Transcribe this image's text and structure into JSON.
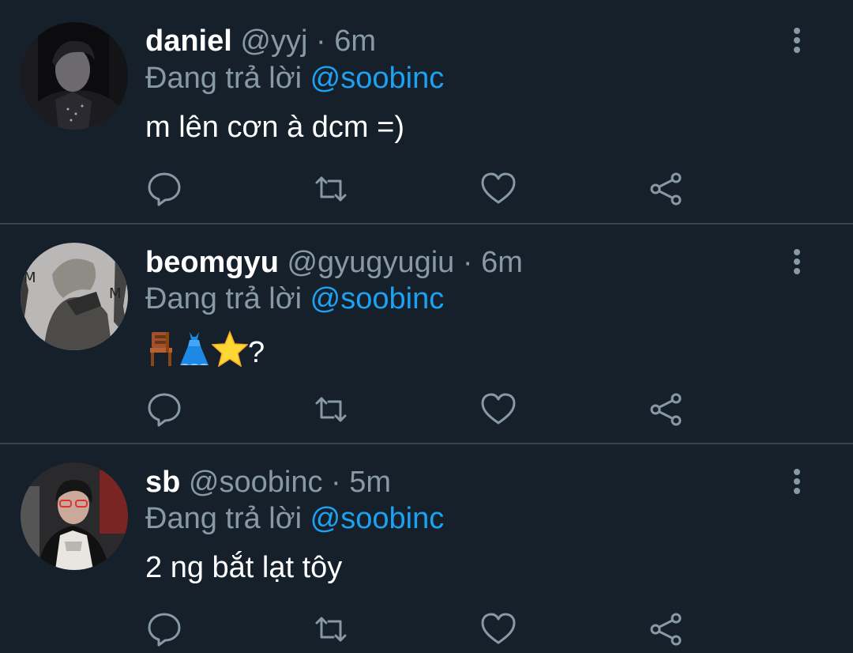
{
  "tweets": [
    {
      "name": "daniel",
      "handle": "@yyj",
      "separator": "·",
      "time": "6m",
      "reply_prefix": "Đang trả lời",
      "reply_to": "@soobinc",
      "text": "m lên cơn à dcm =)"
    },
    {
      "name": "beomgyu",
      "handle": "@gyugyugiu",
      "separator": "·",
      "time": "6m",
      "reply_prefix": "Đang trả lời",
      "reply_to": "@soobinc",
      "emojis": [
        "chair",
        "dress",
        "star"
      ],
      "text": "?"
    },
    {
      "name": "sb",
      "handle": "@soobinc",
      "separator": "·",
      "time": "5m",
      "reply_prefix": "Đang trả lời",
      "reply_to": "@soobinc",
      "text": "2 ng bắt lạt tôy"
    }
  ],
  "icons": {
    "reply": "reply-icon",
    "retweet": "retweet-icon",
    "like": "heart-icon",
    "share": "share-icon",
    "more": "more-vertical-icon"
  },
  "colors": {
    "background": "#15202b",
    "divider": "#38444d",
    "primary_text": "#ffffff",
    "secondary_text": "#8899a6",
    "mention": "#1da1f2"
  }
}
